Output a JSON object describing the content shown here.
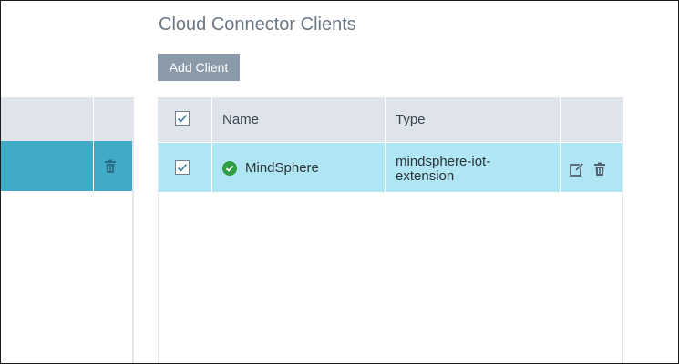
{
  "section": {
    "title": "Cloud Connector Clients",
    "add_button": "Add Client"
  },
  "table": {
    "columns": [
      "",
      "Name",
      "Type",
      ""
    ],
    "rows": [
      {
        "selected": true,
        "status": "connected",
        "name": "MindSphere",
        "type": "mindsphere-iot-extension"
      }
    ]
  },
  "left_panel": {
    "rows": [
      {
        "selected": true
      }
    ]
  },
  "colors": {
    "header_bg": "#dfe4ea",
    "row_selected": "#b0e6f3",
    "left_row_selected": "#41aac6",
    "button_bg": "#8a9aa8",
    "status_ok": "#2e9e40"
  },
  "icons": {
    "select_all": "checkbox-checked-icon",
    "status": "check-circle-icon",
    "edit": "edit-icon",
    "delete": "trash-icon"
  }
}
